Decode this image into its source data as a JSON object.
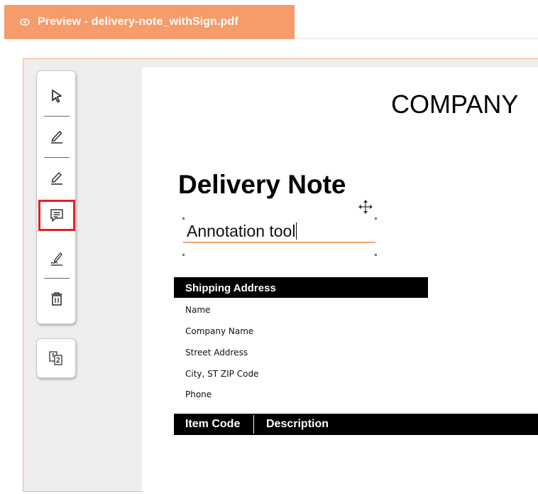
{
  "tab": {
    "title": "Preview - delivery-note_withSign.pdf",
    "icon": "eye-icon",
    "color": "#f69b6a"
  },
  "toolbar": {
    "tools": [
      {
        "name": "select",
        "icon": "cursor-icon"
      },
      {
        "name": "draw",
        "icon": "pen-icon"
      },
      {
        "name": "highlight",
        "icon": "highlighter-icon"
      },
      {
        "name": "annotation",
        "icon": "comment-icon",
        "selected": true
      },
      {
        "name": "signature",
        "icon": "signature-icon"
      },
      {
        "name": "delete",
        "icon": "trash-icon"
      }
    ],
    "pages_icon": "page-numbers-icon",
    "selected_outline_color": "#e3202b"
  },
  "document": {
    "company": "COMPANY",
    "title": "Delivery Note",
    "annotation_text": "Annotation tool",
    "shipping": {
      "header": "Shipping Address",
      "lines": [
        "Name",
        "Company Name",
        "Street Address",
        "City, ST  ZIP Code",
        "Phone"
      ]
    },
    "items_table": {
      "columns": [
        "Item Code",
        "Description"
      ]
    }
  }
}
